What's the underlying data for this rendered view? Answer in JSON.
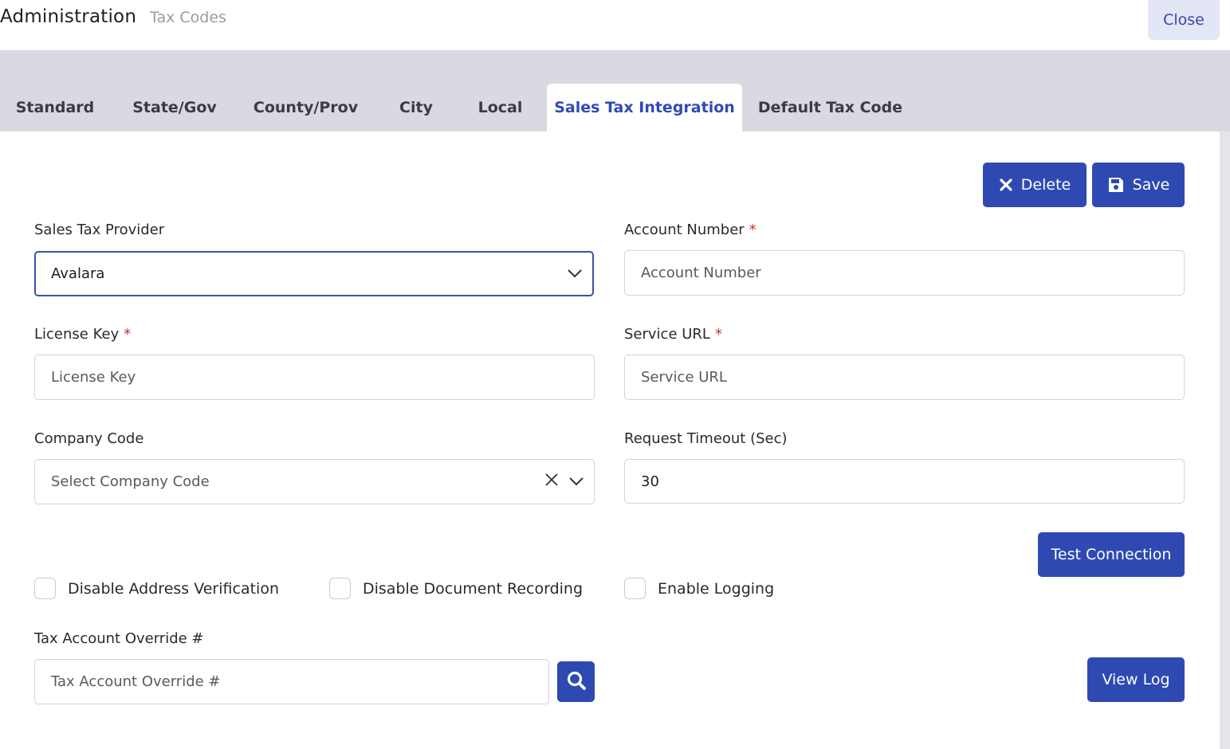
{
  "header": {
    "title": "Administration",
    "breadcrumb": "Tax Codes",
    "close_label": "Close"
  },
  "tabs": [
    {
      "label": "Standard",
      "active": false
    },
    {
      "label": "State/Gov",
      "active": false
    },
    {
      "label": "County/Prov",
      "active": false
    },
    {
      "label": "City",
      "active": false
    },
    {
      "label": "Local",
      "active": false
    },
    {
      "label": "Sales Tax Integration",
      "active": true
    },
    {
      "label": "Default Tax Code",
      "active": false
    }
  ],
  "toolbar": {
    "delete_label": "Delete",
    "save_label": "Save"
  },
  "form": {
    "sales_tax_provider": {
      "label": "Sales Tax Provider",
      "value": "Avalara"
    },
    "account_number": {
      "label": "Account Number",
      "required": "*",
      "placeholder": "Account Number"
    },
    "license_key": {
      "label": "License Key",
      "required": "*",
      "placeholder": "License Key"
    },
    "service_url": {
      "label": "Service URL",
      "required": "*",
      "placeholder": "Service URL"
    },
    "company_code": {
      "label": "Company Code",
      "placeholder": "Select Company Code"
    },
    "request_timeout": {
      "label": "Request Timeout (Sec)",
      "value": "30"
    },
    "test_connection_label": "Test Connection",
    "checkboxes": [
      {
        "label": "Disable Address Verification",
        "checked": false
      },
      {
        "label": "Disable Document Recording",
        "checked": false
      },
      {
        "label": "Enable Logging",
        "checked": false
      }
    ],
    "tax_account_override": {
      "label": "Tax Account Override #",
      "placeholder": "Tax Account Override #"
    },
    "view_log_label": "View Log"
  },
  "icons": {
    "delete": "close-icon",
    "save": "floppy-disk-icon",
    "dropdown": "chevron-down-icon",
    "clear": "clear-x-icon",
    "search": "search-icon"
  },
  "colors": {
    "primary": "#2f49b3",
    "tab_bar": "#d9d9e2",
    "active_tab_text": "#2f4bb5",
    "required": "#d12b2b"
  }
}
